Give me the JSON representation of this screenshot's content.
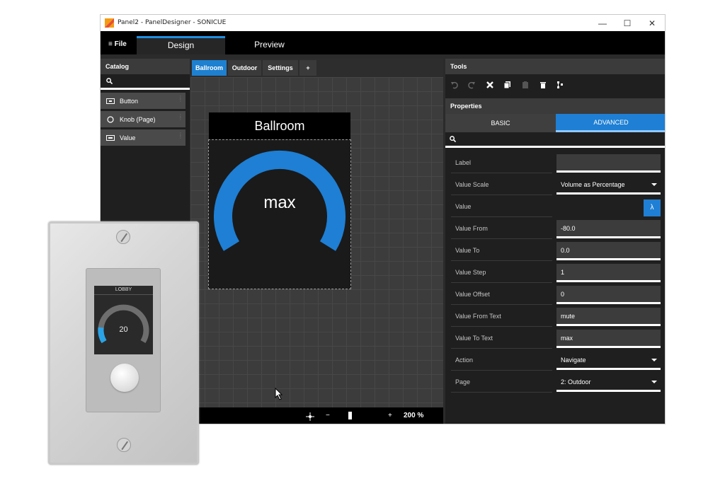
{
  "window": {
    "title": "Panel2 - PanelDesigner - SONICUE",
    "controls": {
      "minimize": "—",
      "maximize": "☐",
      "close": "✕"
    }
  },
  "menubar": {
    "file_label": "≡ File",
    "modes": [
      {
        "label": "Design",
        "active": true
      },
      {
        "label": "Preview",
        "active": false
      }
    ]
  },
  "catalog": {
    "header": "Catalog",
    "items": [
      {
        "label": "Button",
        "icon": "button-icon"
      },
      {
        "label": "Knob (Page)",
        "icon": "circle-icon"
      },
      {
        "label": "Value",
        "icon": "value-icon"
      }
    ]
  },
  "page_tabs": {
    "tabs": [
      {
        "label": "Ballroom",
        "active": true
      },
      {
        "label": "Outdoor",
        "active": false
      },
      {
        "label": "Settings",
        "active": false
      },
      {
        "label": "+",
        "active": false
      }
    ]
  },
  "canvas": {
    "page_title": "Ballroom",
    "knob_value_text": "max",
    "knob_color": "#1e7fd4",
    "zoom": "200 %",
    "zoom_minus": "−",
    "zoom_plus": "+"
  },
  "tools": {
    "header": "Tools",
    "buttons": [
      "undo-icon",
      "redo-icon",
      "delete-icon",
      "copy-icon",
      "paste-icon",
      "trash-icon",
      "align-icon"
    ]
  },
  "properties": {
    "header": "Properties",
    "tabs": {
      "basic": "BASIC",
      "advanced": "ADVANCED"
    },
    "lambda": "λ",
    "rows": [
      {
        "label": "Label",
        "value": "",
        "type": "text"
      },
      {
        "label": "Value Scale",
        "value": "Volume as Percentage",
        "type": "select"
      },
      {
        "label": "Value",
        "value": "",
        "type": "lambda"
      },
      {
        "label": "Value From",
        "value": "-80.0",
        "type": "text"
      },
      {
        "label": "Value To",
        "value": "0.0",
        "type": "text"
      },
      {
        "label": "Value Step",
        "value": "1",
        "type": "text"
      },
      {
        "label": "Value Offset",
        "value": "0",
        "type": "text"
      },
      {
        "label": "Value From Text",
        "value": "mute",
        "type": "text"
      },
      {
        "label": "Value To Text",
        "value": "max",
        "type": "text"
      },
      {
        "label": "Action",
        "value": "Navigate",
        "type": "select"
      },
      {
        "label": "Page",
        "value": "2: Outdoor",
        "type": "select"
      }
    ]
  },
  "device": {
    "title": "LOBBY",
    "value": "20",
    "accent": "#2aa3e6"
  }
}
